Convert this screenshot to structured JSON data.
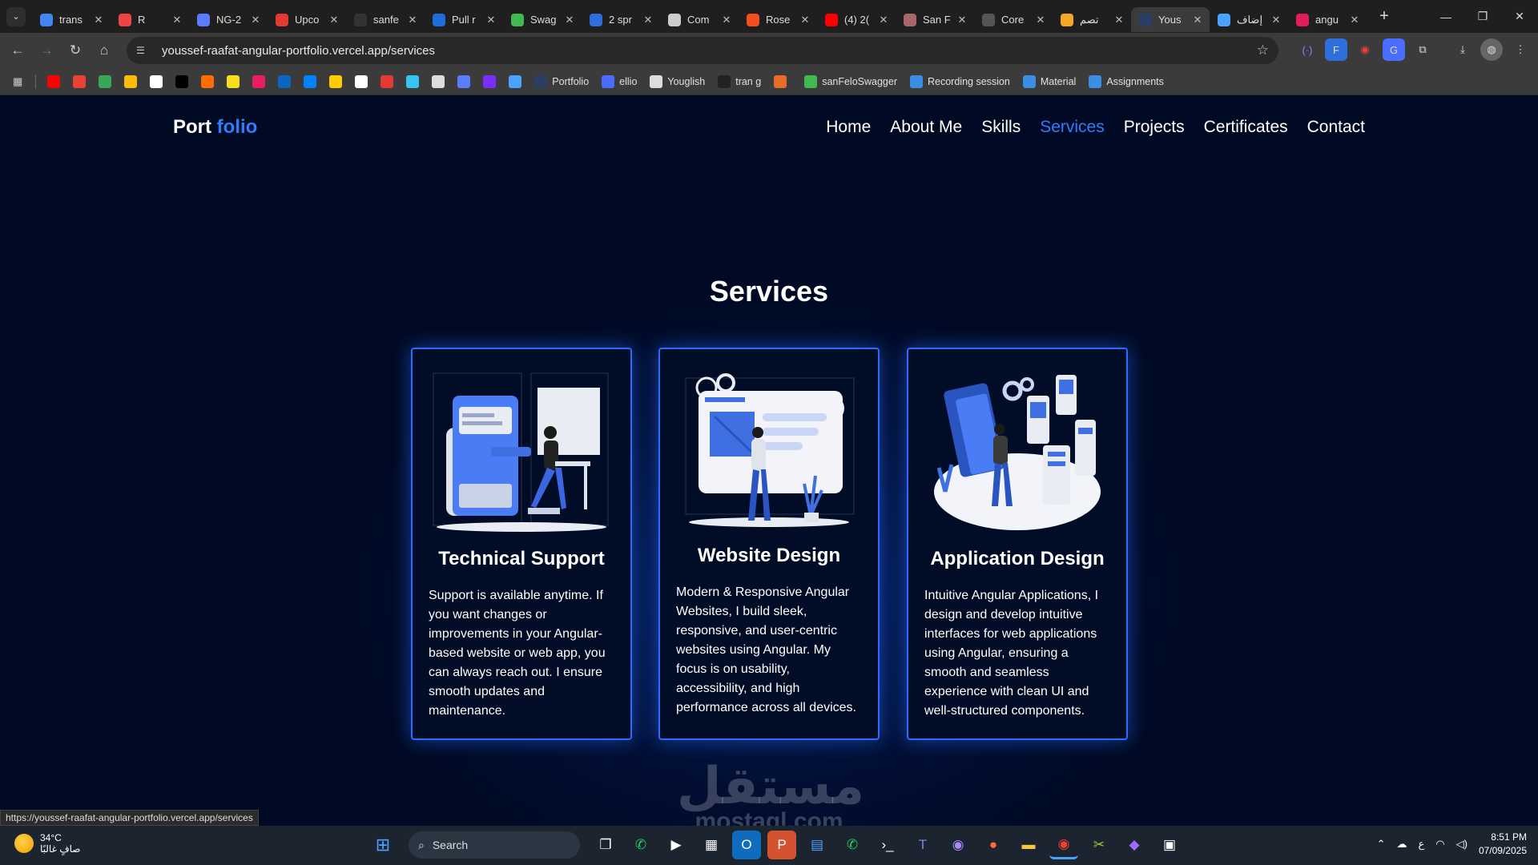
{
  "browser": {
    "tabs": [
      {
        "title": "trans",
        "color": "#4285f4",
        "active": false
      },
      {
        "title": "R",
        "color": "#e44",
        "active": false
      },
      {
        "title": "NG-2",
        "color": "#5a7cff",
        "active": false
      },
      {
        "title": "Upco",
        "color": "#e53935",
        "active": false
      },
      {
        "title": "sanfe",
        "color": "#333",
        "active": false
      },
      {
        "title": "Pull r",
        "color": "#1e6fd9",
        "active": false
      },
      {
        "title": "Swag",
        "color": "#3fb950",
        "active": false
      },
      {
        "title": "2 spr",
        "color": "#2f6fdb",
        "active": false
      },
      {
        "title": "Com",
        "color": "#ccc",
        "active": false
      },
      {
        "title": "Rose",
        "color": "#f24e1e",
        "active": false
      },
      {
        "title": "(4) 2(",
        "color": "#ff0000",
        "active": false
      },
      {
        "title": "San F",
        "color": "#a66",
        "active": false
      },
      {
        "title": "Core",
        "color": "#555",
        "active": false
      },
      {
        "title": "تصم",
        "color": "#f5a623",
        "active": false
      },
      {
        "title": "Yous",
        "color": "#2c3e66",
        "active": true
      },
      {
        "title": "إضاف",
        "color": "#4aa3ff",
        "active": false
      },
      {
        "title": "angu",
        "color": "#e01e5a",
        "active": false
      }
    ],
    "close_glyph": "✕",
    "new_tab_glyph": "+",
    "url": "youssef-raafat-angular-portfolio.vercel.app/services",
    "bookmarks": [
      {
        "label": "Portfolio",
        "color": "#2c3e66"
      },
      {
        "label": "ellio",
        "color": "#4a6cff"
      },
      {
        "label": "Youglish",
        "color": "#ddd"
      },
      {
        "label": "tran g",
        "color": "#222"
      },
      {
        "label": "",
        "color": "#e86b2a"
      },
      {
        "label": "sanFeloSwagger",
        "color": "#3fb950"
      },
      {
        "label": "Recording session",
        "color": "#3a8ee6"
      },
      {
        "label": "Material",
        "color": "#3a8ee6"
      },
      {
        "label": "Assignments",
        "color": "#3a8ee6"
      }
    ],
    "bookmark_icons": [
      "#ff0000",
      "#ea4335",
      "#34a853",
      "#fbbc05",
      "#ffffff",
      "#000000",
      "#ff6d00",
      "#f7df1e",
      "#e91e63",
      "#0a66c2",
      "#0084ff",
      "#ffcc00",
      "#ffffff",
      "#e53935",
      "#36c5f0",
      "#dddddd",
      "#5a7cff",
      "#7b2cff",
      "#4aa3ff"
    ],
    "status_url": "https://youssef-raafat-angular-portfolio.vercel.app/services"
  },
  "site": {
    "logo_main": "Port ",
    "logo_accent": "folio",
    "nav": [
      {
        "label": "Home",
        "active": false
      },
      {
        "label": "About Me",
        "active": false
      },
      {
        "label": "Skills",
        "active": false
      },
      {
        "label": "Services",
        "active": true
      },
      {
        "label": "Projects",
        "active": false
      },
      {
        "label": "Certificates",
        "active": false
      },
      {
        "label": "Contact",
        "active": false
      }
    ],
    "section_title": "Services",
    "services": [
      {
        "title": "Technical Support",
        "description": "Support is available anytime. If you want changes or improvements in your Angular-based website or web app, you can always reach out. I ensure smooth updates and maintenance.",
        "illustration": "technical-support-illustration"
      },
      {
        "title": "Website Design",
        "description": "Modern & Responsive Angular Websites, I build sleek, responsive, and user-centric websites using Angular. My focus is on usability, accessibility, and high performance across all devices.",
        "illustration": "website-design-illustration"
      },
      {
        "title": "Application Design",
        "description": "Intuitive Angular Applications, I design and develop intuitive interfaces for web applications using Angular, ensuring a smooth and seamless experience with clean UI and well-structured components.",
        "illustration": "application-design-illustration"
      }
    ],
    "watermark_ar": "مستقل",
    "watermark_lat": "mostaql.com",
    "accent": "#2f7dff"
  },
  "taskbar": {
    "weather_temp": "34°C",
    "weather_desc": "صافٍ غالبًا",
    "search_label": "Search",
    "ime": "ع",
    "time": "8:51 PM",
    "date": "07/09/2025"
  }
}
